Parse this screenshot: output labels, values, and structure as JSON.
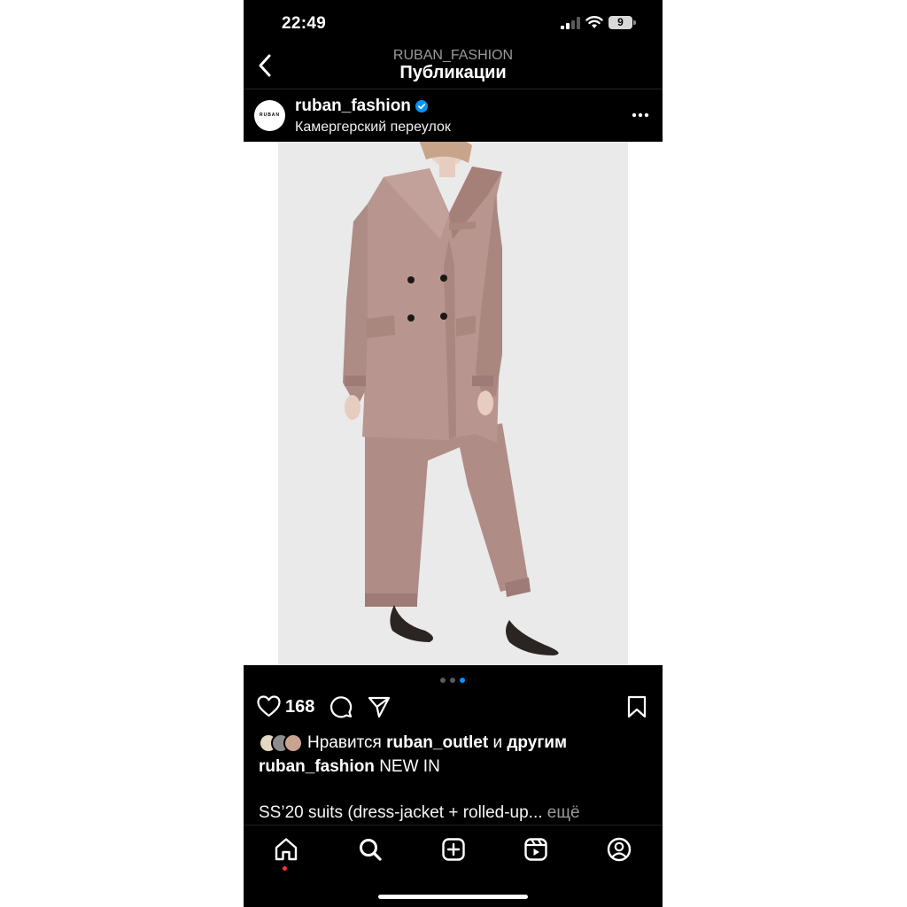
{
  "status_bar": {
    "time": "22:49",
    "battery": "9",
    "icons": [
      "signal-icon",
      "wifi-icon",
      "battery-icon"
    ]
  },
  "nav": {
    "subtitle": "RUBAN_FASHION",
    "title": "Публикации",
    "back_icon": "chevron-left-icon"
  },
  "post": {
    "avatar_text": "RUBAN",
    "author": "ruban_fashion",
    "location": "Камергерский переулок",
    "verified_icon": "verified-badge-icon",
    "more_icon": "more-horizontal-icon",
    "image_description_icon": "photo",
    "carousel": {
      "count": 3,
      "active_index": 2
    },
    "likes_count": "168",
    "liked_by_prefix": "Нравится",
    "liked_by_user": "ruban_outlet",
    "liked_by_joiner": "и",
    "liked_by_suffix": "другим",
    "caption_author": "ruban_fashion",
    "caption_first": "NEW IN",
    "caption_second": "SS’20 suits (dress-jacket + rolled-up...",
    "more_label": "ещё"
  },
  "colors": {
    "background": "#000000",
    "accent_blue": "#0095f6",
    "notification_red": "#ff3040",
    "suit_color": "#b8968f"
  },
  "tabs": [
    {
      "name": "home",
      "icon": "home-icon"
    },
    {
      "name": "search",
      "icon": "search-icon"
    },
    {
      "name": "create",
      "icon": "plus-square-icon"
    },
    {
      "name": "reels",
      "icon": "reels-icon"
    },
    {
      "name": "profile",
      "icon": "profile-icon"
    }
  ]
}
